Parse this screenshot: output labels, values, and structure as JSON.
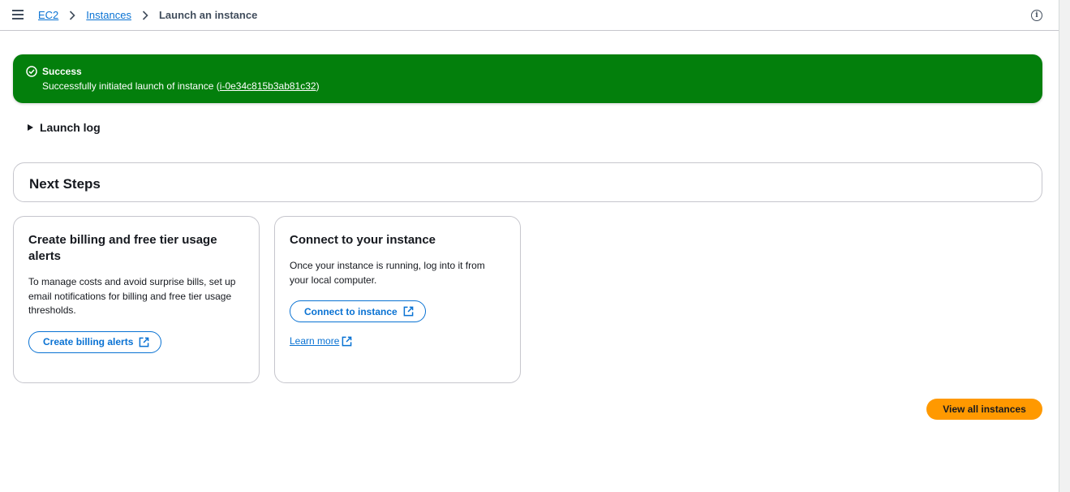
{
  "breadcrumbs": {
    "items": [
      {
        "label": "EC2"
      },
      {
        "label": "Instances"
      }
    ],
    "current": "Launch an instance"
  },
  "flash": {
    "title": "Success",
    "message_prefix": "Successfully initiated launch of instance (",
    "instance_id": "i-0e34c815b3ab81c32",
    "message_suffix": ")",
    "color": "#037f0c"
  },
  "launch_log": {
    "label": "Launch log"
  },
  "next_steps": {
    "title": "Next Steps"
  },
  "cards": [
    {
      "title": "Create billing and free tier usage alerts",
      "body": "To manage costs and avoid surprise bills, set up email notifications for billing and free tier usage thresholds.",
      "button_label": "Create billing alerts"
    },
    {
      "title": "Connect to your instance",
      "body": "Once your instance is running, log into it from your local computer.",
      "button_label": "Connect to instance",
      "link_label": "Learn more"
    }
  ],
  "footer": {
    "primary_button": "View all instances",
    "primary_color": "#ff9900"
  },
  "colors": {
    "link": "#0972d3",
    "text": "#16191f"
  }
}
